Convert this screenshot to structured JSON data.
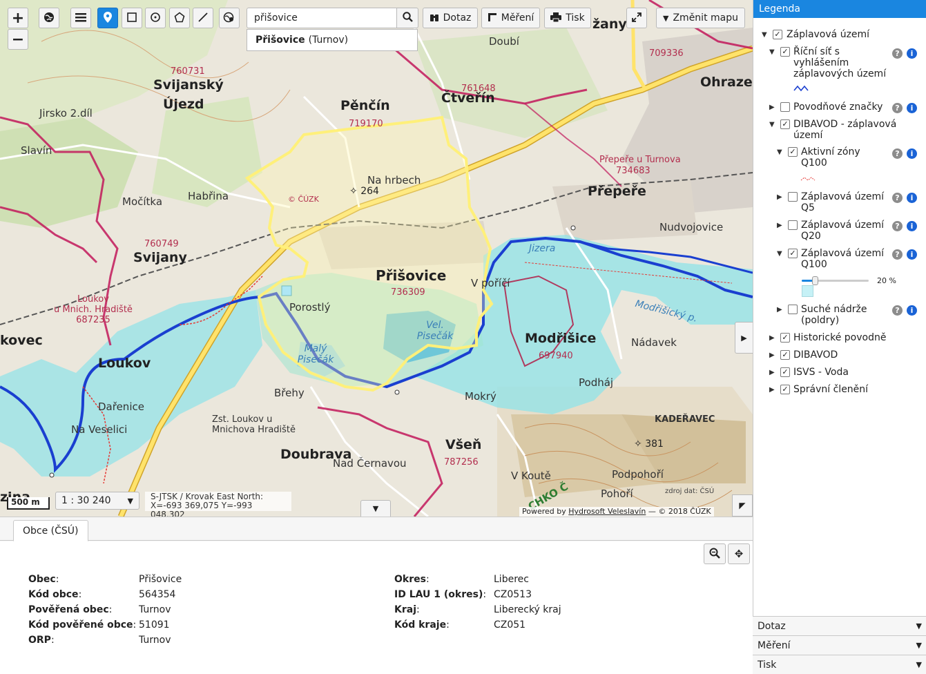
{
  "toolbar": {
    "zoom_in_label": "+",
    "zoom_out_label": "−",
    "query_label": "Dotaz",
    "measure_label": "Měření",
    "print_label": "Tisk",
    "change_map_label": "Změnit mapu"
  },
  "search": {
    "value": "přišovice",
    "suggestion_main": "Přišovice",
    "suggestion_sub": "(Turnov)"
  },
  "map": {
    "scale_bar": "500 m",
    "scale_value": "1 : 30 240",
    "crs": "S-JTSK / Krovak East North:",
    "coords": "X=-693 369,075 Y=-993 048,302",
    "attribution_prefix": "Powered by",
    "attribution_link": "Hydrosoft Veleslavín",
    "attribution_suffix": "— © 2018 ČÚZK",
    "source_note": "zdroj dat: ČSÚ",
    "labels": {
      "svijansky_ujezd_code": "760731",
      "svijansky_ujezd_1": "Svijanský",
      "svijansky_ujezd_2": "Újezd",
      "pencin": "Pěnčín",
      "pencin_code": "719170",
      "ctverin": "Čtveřín",
      "ctverin_code": "761648",
      "doubi": "Doubí",
      "jirsko": "Jirsko 2.díl",
      "slavin": "Slavín",
      "mocitka": "Močítka",
      "habrina": "Habřina",
      "svijany": "Svijany",
      "svijany_code": "760749",
      "na_hrbech": "Na hrbech",
      "elev_264": "264",
      "cuzk": "© ČÚZK",
      "prisovice": "Přišovice",
      "prisovice_code": "736309",
      "porostly": "Porostlý",
      "maly_pisecak": "Malý Pisečák",
      "vel_pisecak": "Vel. Pisečák",
      "v_porici": "V poříčí",
      "jizera": "Jizera",
      "modrisice": "Modřišice",
      "modrisice_code": "697940",
      "nadavek": "Nádavek",
      "modrisicky_p": "Modřišický p.",
      "podhaj": "Podháj",
      "prepere": "Přepeře",
      "prepere_code": "734683",
      "prepere_turnova": "Přepeře u Turnova",
      "nudvojovice": "Nudvojovice",
      "ohraze": "Ohraze",
      "loukov": "Loukov",
      "loukov_mnich_1": "Loukov",
      "loukov_mnich_2": "u Mnich. Hradiště",
      "loukov_mnich_code": "687235",
      "darenice": "Dařenice",
      "na_veselici": "Na Veselici",
      "zst_loukov": "Zst. Loukov u Mnichova Hradiště",
      "doubrava": "Doubrava",
      "nad_cernavou": "Nad Černavou",
      "brehy": "Břehy",
      "vsen": "Všeň",
      "vsen_code": "787256",
      "mokry": "Mokrý",
      "kadeavec": "KADEŘAVEC",
      "elev_381": "381",
      "podpohori": "Podpohoří",
      "pohori": "Pohoří",
      "v_koute": "V Koutě",
      "chko": "CHKO Č",
      "kovec": "kovec",
      "zazany": "žany",
      "turnov_code": "709336",
      "zina": "zina"
    }
  },
  "info_panel": {
    "tab": "Obce (ČSÚ)",
    "left": [
      {
        "key": "Obec",
        "value": "Přišovice"
      },
      {
        "key": "Kód obce",
        "value": "564354"
      },
      {
        "key": "Pověřená obec",
        "value": "Turnov"
      },
      {
        "key": "Kód pověřené obce",
        "value": "51091"
      },
      {
        "key": "ORP",
        "value": "Turnov"
      }
    ],
    "right": [
      {
        "key": "Okres",
        "value": "Liberec"
      },
      {
        "key": "ID LAU 1 (okres)",
        "value": "CZ0513"
      },
      {
        "key": "Kraj",
        "value": "Liberecký kraj"
      },
      {
        "key": "Kód kraje",
        "value": "CZ051"
      }
    ]
  },
  "legend": {
    "title": "Legenda",
    "items": [
      {
        "label": "Záplavová území",
        "checked": true
      },
      {
        "label": "Říční síť s vyhlášením záplavových území",
        "checked": true
      },
      {
        "label": "Povodňové značky",
        "checked": false
      },
      {
        "label": "DIBAVOD - záplavová území",
        "checked": true
      },
      {
        "label": "Aktivní zóny Q100",
        "checked": true
      },
      {
        "label": "Záplavová území Q5",
        "checked": false
      },
      {
        "label": "Záplavová území Q20",
        "checked": false
      },
      {
        "label": "Záplavová území Q100",
        "checked": true
      },
      {
        "label": "Suché nádrže (poldry)",
        "checked": false
      },
      {
        "label": "Historické povodně",
        "checked": true
      },
      {
        "label": "DIBAVOD",
        "checked": true
      },
      {
        "label": "ISVS - Voda",
        "checked": true
      },
      {
        "label": "Správní členění",
        "checked": true
      }
    ],
    "opacity_label": "20 %",
    "opacity_value": 0.2
  },
  "accordion": {
    "query": "Dotaz",
    "measure": "Měření",
    "print": "Tisk"
  },
  "colors": {
    "accent": "#1a86e0",
    "river": "#1a3fd0",
    "flood": "#8fe3e8",
    "boundary_yellow": "#fff07a",
    "admin_border": "#c2185b",
    "road": "#e3c23a"
  }
}
